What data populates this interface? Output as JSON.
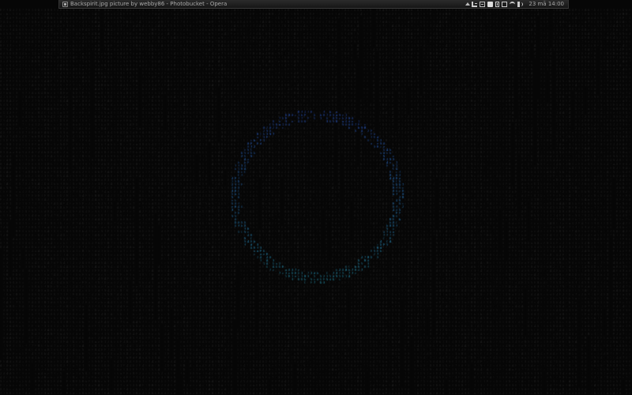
{
  "panel": {
    "window_title": "Backspirit.jpg picture by webby86 - Photobucket - Opera",
    "clock": "23 mā 14:00",
    "tray_icons": [
      "updates-icon",
      "network-icon",
      "keyboard-icon",
      "messages-icon",
      "battery-icon",
      "display-icon",
      "wifi-icon",
      "volume-icon"
    ]
  },
  "wallpaper": {
    "style": "matrix digital rain with circular ring",
    "background_color": "#060606",
    "glyph_color": "#1f1f1f",
    "ring_color_top": "#2f5fd6",
    "ring_color_bottom": "#2aa0c0"
  }
}
